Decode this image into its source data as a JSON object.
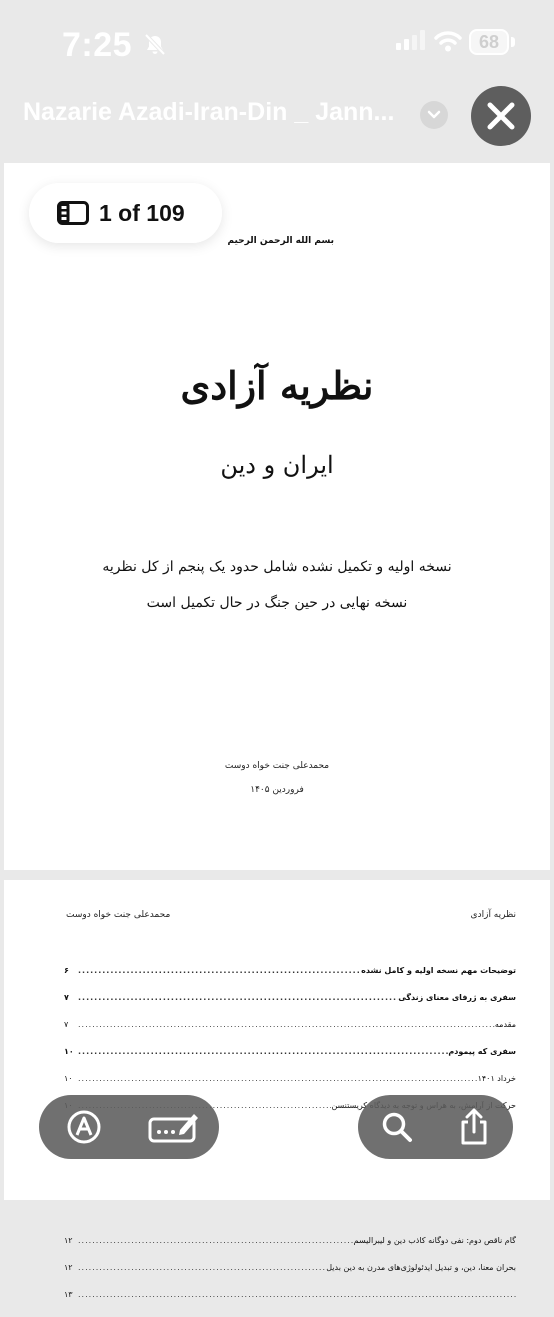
{
  "status_bar": {
    "time": "7:25",
    "battery": "68"
  },
  "title_bar": {
    "title": "Nazarie Azadi-Iran-Din _ Jann..."
  },
  "page_counter": {
    "text": "1 of 109"
  },
  "page1": {
    "bismillah": "بسم الله الرحمن الرحیم",
    "title": "نظریه آزادی",
    "subtitle": "ایران و دین",
    "note_line1": "نسخه اولیه و تکمیل نشده شامل حدود یک پنجم از کل نظریه",
    "note_line2": "نسخه نهایی در حین جنگ در حال تکمیل است",
    "author": "محمدعلی جنت خواه دوست",
    "date": "فروردین ۱۴۰۵"
  },
  "page2": {
    "header_right": "نظریه آزادی",
    "header_left": "محمدعلی جنت خواه دوست",
    "toc": [
      {
        "label": "توضیحات مهم نسخه اولیه و کامل نشده",
        "page": "۶",
        "bold": true
      },
      {
        "label": "سفری به ژرفای معنای زندگی",
        "page": "۷",
        "bold": true
      },
      {
        "label": "مقدمه",
        "page": "۷",
        "bold": false
      },
      {
        "label": "سفری که پیمودم",
        "page": "۱۰",
        "bold": true
      },
      {
        "label": "خرداد ۱۴۰۱",
        "page": "۱۰",
        "bold": false
      },
      {
        "label": "حرکت از آرامش، به هراس و توجه به دیدگاه کریستنسن",
        "page": "۱۰",
        "bold": false
      },
      {
        "label": "",
        "page": "",
        "bold": false
      },
      {
        "label": "",
        "page": "",
        "bold": false
      },
      {
        "label": "",
        "page": "",
        "bold": false
      },
      {
        "label": "",
        "page": "",
        "bold": false
      },
      {
        "label": "گام ناقص دوم: نفی دوگانه کاذب دین و لیبرالیسم",
        "page": "۱۲",
        "bold": false
      },
      {
        "label": "بحران معنا، دین، و تبدیل ایدئولوژی‌های مدرن به دین بدیل",
        "page": "۱۲",
        "bold": false
      },
      {
        "label": "",
        "page": "۱۳",
        "bold": false
      }
    ]
  },
  "toolbar": {
    "left": [
      "markup-icon",
      "edit-text-icon"
    ],
    "right": [
      "search-icon",
      "share-icon"
    ]
  }
}
